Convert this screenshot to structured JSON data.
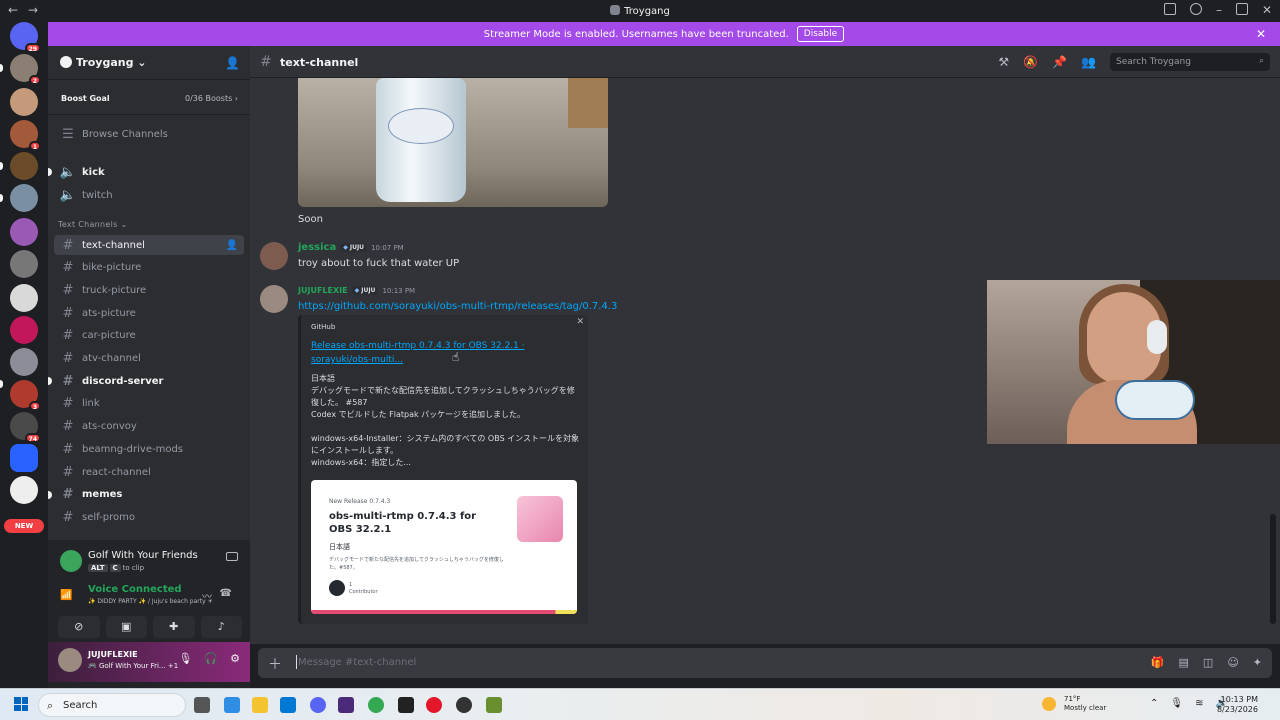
{
  "window": {
    "title": "Troygang"
  },
  "banner": {
    "text": "Streamer Mode is enabled. Usernames have been truncated.",
    "disable_label": "Disable"
  },
  "guilds": {
    "badges": [
      "29",
      "2",
      "1",
      "3",
      "74"
    ],
    "new_label": "NEW"
  },
  "server": {
    "name": "Troygang"
  },
  "boost": {
    "label": "Boost Goal",
    "progress": "0/36 Boosts"
  },
  "sidebar": {
    "browse": "Browse Channels",
    "voice_channels": [
      "kick",
      "twitch"
    ],
    "category": "Text Channels",
    "channels": [
      {
        "name": "text-channel",
        "state": "active"
      },
      {
        "name": "bike-picture",
        "state": "read"
      },
      {
        "name": "truck-picture",
        "state": "read"
      },
      {
        "name": "ats-picture",
        "state": "read"
      },
      {
        "name": "car-picture",
        "state": "read"
      },
      {
        "name": "atv-channel",
        "state": "read"
      },
      {
        "name": "discord-server",
        "state": "unread"
      },
      {
        "name": "link",
        "state": "read"
      },
      {
        "name": "ats-convoy",
        "state": "read"
      },
      {
        "name": "beamng-drive-mods",
        "state": "read"
      },
      {
        "name": "react-channel",
        "state": "read"
      },
      {
        "name": "memes",
        "state": "unread"
      },
      {
        "name": "self-promo",
        "state": "read"
      }
    ]
  },
  "activity": {
    "game": "Golf With Your Friends",
    "key1": "ALT",
    "key2": "C",
    "clip": "to clip"
  },
  "voice": {
    "status": "Voice Connected",
    "channel": "✨ DIDDY PARTY ✨ / Juju's beach party ☀"
  },
  "user": {
    "name": "JUJUFLEXIE",
    "status": "🎮 Golf With Your Fri...",
    "extra": "+1"
  },
  "chat": {
    "channel": "text-channel",
    "search_placeholder": "Search Troygang",
    "composer_placeholder": "Message #text-channel"
  },
  "messages": [
    {
      "text": "Soon"
    },
    {
      "author": "jessica",
      "tag": "JUJU",
      "time": "10:07 PM",
      "text": "troy about to fuck that water UP"
    },
    {
      "author": "JUJUFLEXIE",
      "tag": "JUJU",
      "time": "10:13 PM",
      "text": "https://github.com/sorayuki/obs-multi-rtmp/releases/tag/0.7.4.3"
    }
  ],
  "embed": {
    "provider": "GitHub",
    "title": "Release obs-multi-rtmp 0.7.4.3 for OBS 32.2.1 · sorayuki/obs-multi...",
    "description": "日本語\nデバッグモードで新たな配信先を追加してクラッシュしちゃうバッグを修復した。 #587\nCodex でビルドした Flatpak パッケージを追加しました。\n\nwindows-x64-Installer：システム内のすべての OBS インストールを対象にインストールします。\nwindows-x64：指定した...",
    "card": {
      "new_release": "New Release 0.7.4.3",
      "title": "obs-multi-rtmp 0.7.4.3 for OBS 32.2.1",
      "lang": "日本語",
      "desc": "デバッグモードで新たな配信先を追加してクラッシュしちゃうバッグを修復した。#587。",
      "contributors_count": "1",
      "contributors_label": "Contributor"
    }
  },
  "taskbar": {
    "search": "Search",
    "temp": "71°F",
    "weather": "Mostly clear",
    "time": "10:13 PM",
    "date": "8/23/2026"
  }
}
